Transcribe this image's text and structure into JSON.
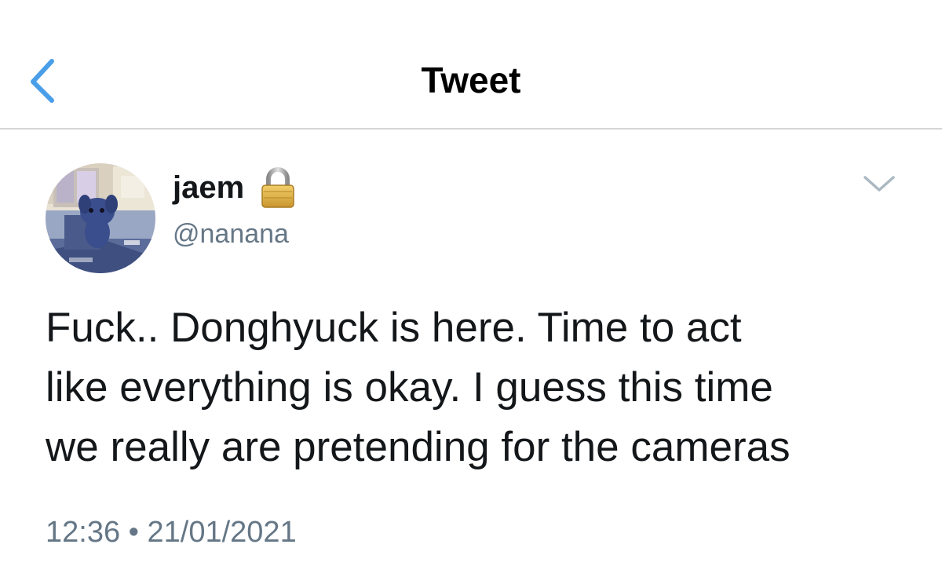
{
  "nav": {
    "title": "Tweet",
    "back_icon": "chevron-left-icon"
  },
  "tweet": {
    "author": {
      "display_name": "jaem",
      "handle": "@nanana",
      "protected_icon": "lock-icon"
    },
    "text": "Fuck.. Donghyuck is here. Time to act\nlike everything is okay. I guess this time\nwe really are pretending for the cameras",
    "timestamp": "12:36 • 21/01/2021",
    "menu_icon": "chevron-down-icon"
  },
  "colors": {
    "accent": "#4a9ee8",
    "secondary_text": "#657786",
    "divider": "#d6d6d8"
  }
}
